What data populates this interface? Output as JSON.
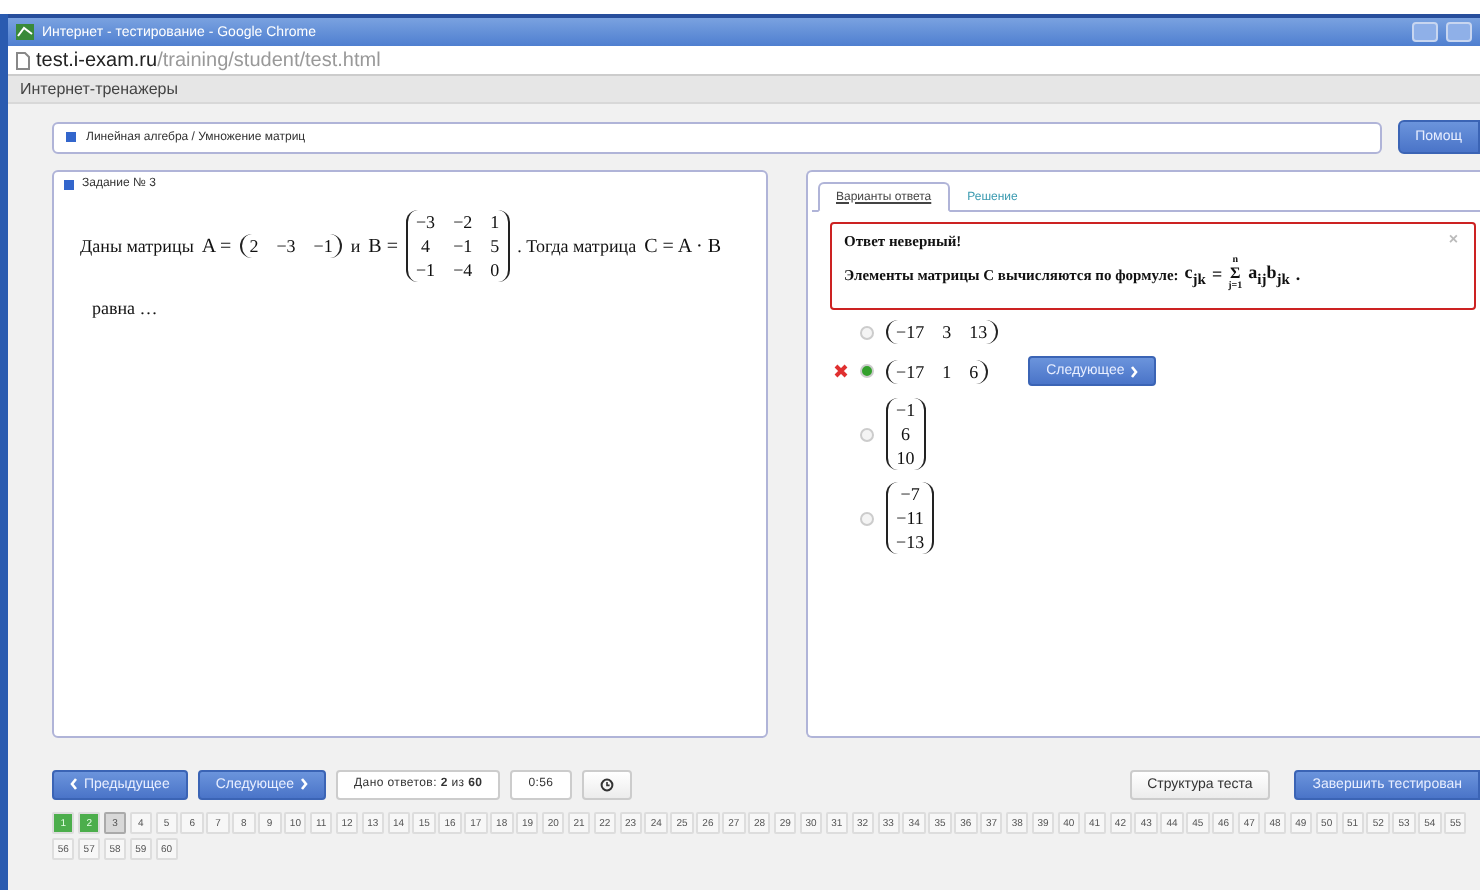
{
  "window": {
    "title": "Интернет - тестирование - Google Chrome"
  },
  "address": {
    "host": "test.i-exam.ru",
    "path": "/training/student/test.html"
  },
  "app_header": "Интернет-тренажеры",
  "breadcrumb": "Линейная алгебра / Умножение матриц",
  "help_button": "Помощ",
  "task": {
    "title": "Задание № 3",
    "segments": [
      {
        "kind": "text",
        "text": "Даны матрицы"
      },
      {
        "kind": "math",
        "text": "A ="
      },
      {
        "kind": "matrix",
        "rows": [
          [
            "2",
            "−3",
            "−1"
          ]
        ]
      },
      {
        "kind": "text",
        "text": "и"
      },
      {
        "kind": "math",
        "text": "B ="
      },
      {
        "kind": "matrix",
        "rows": [
          [
            "−3",
            "−2",
            "1"
          ],
          [
            "4",
            "−1",
            "5"
          ],
          [
            "−1",
            "−4",
            "0"
          ]
        ]
      },
      {
        "kind": "text",
        "text": ". Тогда матрица"
      },
      {
        "kind": "math",
        "text": "C = A · B"
      }
    ],
    "tail": "равна …"
  },
  "tabs": [
    {
      "label": "Варианты ответа",
      "selected": true
    },
    {
      "label": "Решение",
      "selected": false
    }
  ],
  "alert": {
    "title": "Ответ неверный!",
    "text": "Элементы матрицы C вычисляются по формуле:",
    "lhs": "c$_{jk}$",
    "eq": "=",
    "sum_top": "n",
    "sum_sign": "Σ",
    "sum_bottom": "j=1",
    "term": "a$_{ij}$b$_{jk}$",
    "end": ".",
    "close": "×"
  },
  "options": [
    {
      "rows": [
        [
          "−17",
          "3",
          "13"
        ]
      ],
      "selected": false,
      "wrong": false
    },
    {
      "rows": [
        [
          "−17",
          "1",
          "6"
        ]
      ],
      "selected": true,
      "wrong": true
    },
    {
      "rows": [
        [
          "−1"
        ],
        [
          "6"
        ],
        [
          "10"
        ]
      ],
      "selected": false,
      "wrong": false
    },
    {
      "rows": [
        [
          "−7"
        ],
        [
          "−11"
        ],
        [
          "−13"
        ]
      ],
      "selected": false,
      "wrong": false
    }
  ],
  "inline_next": "Следующее",
  "nav": {
    "prev": "Предыдущее",
    "next": "Следующее",
    "answered": "Дано ответов: **2** из **60**",
    "timer": "0:56",
    "structure": "Структура теста",
    "finish": "Завершить тестирован"
  },
  "pages": [
    {
      "label": "1",
      "answered": true,
      "selected": false
    },
    {
      "label": "2",
      "answered": true,
      "selected": false
    },
    {
      "label": "3",
      "answered": false,
      "selected": true
    },
    {
      "label": "4",
      "answered": false,
      "selected": false
    },
    {
      "label": "5",
      "answered": false,
      "selected": false
    },
    {
      "label": "6",
      "answered": false,
      "selected": false
    },
    {
      "label": "7",
      "answered": false,
      "selected": false
    },
    {
      "label": "8",
      "answered": false,
      "selected": false
    },
    {
      "label": "9",
      "answered": false,
      "selected": false
    },
    {
      "label": "10",
      "answered": false,
      "selected": false
    },
    {
      "label": "11",
      "answered": false,
      "selected": false
    },
    {
      "label": "12",
      "answered": false,
      "selected": false
    },
    {
      "label": "13",
      "answered": false,
      "selected": false
    },
    {
      "label": "14",
      "answered": false,
      "selected": false
    },
    {
      "label": "15",
      "answered": false,
      "selected": false
    },
    {
      "label": "16",
      "answered": false,
      "selected": false
    },
    {
      "label": "17",
      "answered": false,
      "selected": false
    },
    {
      "label": "18",
      "answered": false,
      "selected": false
    },
    {
      "label": "19",
      "answered": false,
      "selected": false
    },
    {
      "label": "20",
      "answered": false,
      "selected": false
    },
    {
      "label": "21",
      "answered": false,
      "selected": false
    },
    {
      "label": "22",
      "answered": false,
      "selected": false
    },
    {
      "label": "23",
      "answered": false,
      "selected": false
    },
    {
      "label": "24",
      "answered": false,
      "selected": false
    },
    {
      "label": "25",
      "answered": false,
      "selected": false
    },
    {
      "label": "26",
      "answered": false,
      "selected": false
    },
    {
      "label": "27",
      "answered": false,
      "selected": false
    },
    {
      "label": "28",
      "answered": false,
      "selected": false
    },
    {
      "label": "29",
      "answered": false,
      "selected": false
    },
    {
      "label": "30",
      "answered": false,
      "selected": false
    },
    {
      "label": "31",
      "answered": false,
      "selected": false
    },
    {
      "label": "32",
      "answered": false,
      "selected": false
    },
    {
      "label": "33",
      "answered": false,
      "selected": false
    },
    {
      "label": "34",
      "answered": false,
      "selected": false
    },
    {
      "label": "35",
      "answered": false,
      "selected": false
    },
    {
      "label": "36",
      "answered": false,
      "selected": false
    },
    {
      "label": "37",
      "answered": false,
      "selected": false
    },
    {
      "label": "38",
      "answered": false,
      "selected": false
    },
    {
      "label": "39",
      "answered": false,
      "selected": false
    },
    {
      "label": "40",
      "answered": false,
      "selected": false
    },
    {
      "label": "41",
      "answered": false,
      "selected": false
    },
    {
      "label": "42",
      "answered": false,
      "selected": false
    },
    {
      "label": "43",
      "answered": false,
      "selected": false
    },
    {
      "label": "44",
      "answered": false,
      "selected": false
    },
    {
      "label": "45",
      "answered": false,
      "selected": false
    },
    {
      "label": "46",
      "answered": false,
      "selected": false
    },
    {
      "label": "47",
      "answered": false,
      "selected": false
    },
    {
      "label": "48",
      "answered": false,
      "selected": false
    },
    {
      "label": "49",
      "answered": false,
      "selected": false
    },
    {
      "label": "50",
      "answered": false,
      "selected": false
    },
    {
      "label": "51",
      "answered": false,
      "selected": false
    },
    {
      "label": "52",
      "answered": false,
      "selected": false
    },
    {
      "label": "53",
      "answered": false,
      "selected": false
    },
    {
      "label": "54",
      "answered": false,
      "selected": false
    },
    {
      "label": "55",
      "answered": false,
      "selected": false
    },
    {
      "label": "56",
      "answered": false,
      "selected": false
    },
    {
      "label": "57",
      "answered": false,
      "selected": false
    },
    {
      "label": "58",
      "answered": false,
      "selected": false
    },
    {
      "label": "59",
      "answered": false,
      "selected": false
    },
    {
      "label": "60",
      "answered": false,
      "selected": false
    }
  ]
}
